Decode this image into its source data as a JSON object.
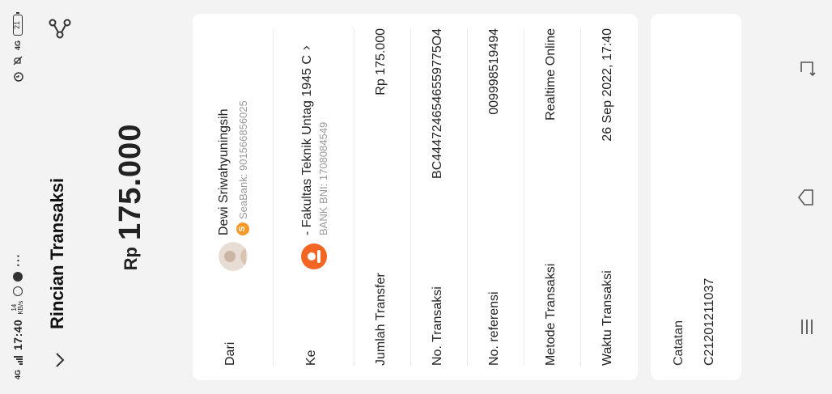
{
  "status_bar": {
    "network": "4G",
    "time": "17:40",
    "speed_value": "14",
    "speed_unit": "KB/s",
    "battery": "21",
    "net2": "4G"
  },
  "header": {
    "title": "Rincian Transaksi"
  },
  "amount": {
    "currency": "Rp",
    "value": "175.000"
  },
  "from": {
    "label": "Dari",
    "name": "Dewi Sriwahyuningsih",
    "bank": "SeaBank: 901566856025"
  },
  "to": {
    "label": "Ke",
    "name": "- Fakultas Teknik Untag 1945 C",
    "bank": "BANK BNI: 1708084549"
  },
  "details": [
    {
      "label": "Jumlah Transfer",
      "value": "Rp 175.000"
    },
    {
      "label": "No. Transaksi",
      "value": "BC4447246546559775O4"
    },
    {
      "label": "No. referensi",
      "value": "009998519494"
    },
    {
      "label": "Metode Transaksi",
      "value": "Realtime Online"
    },
    {
      "label": "Waktu Transaksi",
      "value": "26 Sep 2022, 17:40"
    }
  ],
  "note": {
    "label": "Catatan",
    "value": "C21201211037"
  },
  "colors": {
    "background": "#f3f3f3",
    "card": "#ffffff",
    "accent_orange": "#f26522",
    "seabank_orange": "#f39a2b"
  }
}
